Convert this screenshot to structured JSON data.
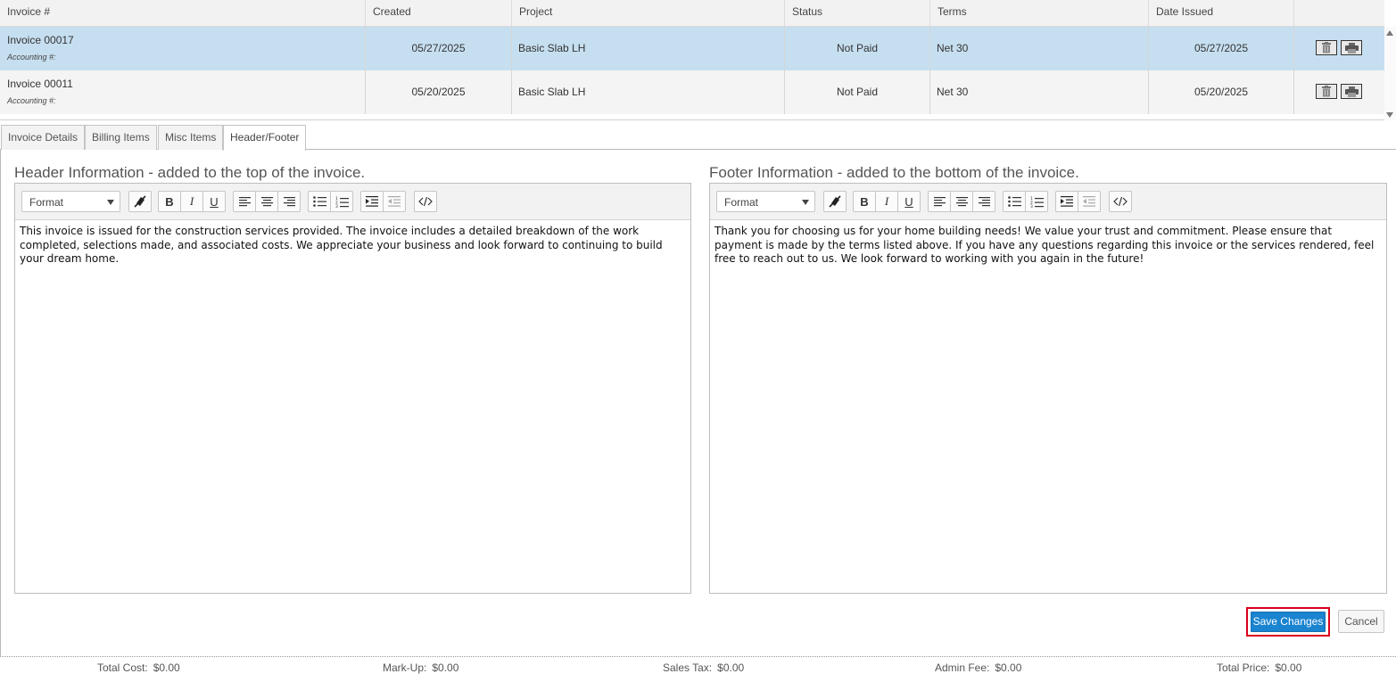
{
  "grid": {
    "columns": [
      "Invoice #",
      "Created",
      "Project",
      "Status",
      "Terms",
      "Date Issued"
    ],
    "rows": [
      {
        "invoice": "Invoice 00017",
        "accounting": "Accounting #:",
        "created": "05/27/2025",
        "project": "Basic Slab LH",
        "status": "Not Paid",
        "terms": "Net 30",
        "date_issued": "05/27/2025",
        "selected": true
      },
      {
        "invoice": "Invoice 00011",
        "accounting": "Accounting #:",
        "created": "05/20/2025",
        "project": "Basic Slab LH",
        "status": "Not Paid",
        "terms": "Net 30",
        "date_issued": "05/20/2025",
        "selected": false
      }
    ],
    "row_icons": [
      "trash-icon",
      "printer-icon"
    ]
  },
  "tabs": [
    {
      "label": "Invoice Details",
      "active": false
    },
    {
      "label": "Billing Items",
      "active": false
    },
    {
      "label": "Misc Items",
      "active": false
    },
    {
      "label": "Header/Footer",
      "active": true
    }
  ],
  "header_section": {
    "title": "Header Information - added to the top of the invoice.",
    "format_label": "Format",
    "content": "This invoice is issued for the construction services provided. The invoice includes a detailed breakdown of the work completed, selections made, and associated costs. We appreciate your business and look forward to continuing to build your dream home."
  },
  "footer_section": {
    "title": "Footer Information - added to the bottom of the invoice.",
    "format_label": "Format",
    "content": "Thank you for choosing us for your home building needs! We value your trust and commitment. Please ensure that payment is made by the terms listed above. If you have any questions regarding this invoice or the services rendered, feel free to reach out to us. We look forward to working with you again in the future!"
  },
  "toolbar_icons": [
    "clear-format-icon",
    "bold-icon",
    "italic-icon",
    "underline-icon",
    "align-left-icon",
    "align-center-icon",
    "align-right-icon",
    "bullet-list-icon",
    "numbered-list-icon",
    "indent-icon",
    "outdent-icon",
    "code-view-icon"
  ],
  "buttons": {
    "save": "Save Changes",
    "cancel": "Cancel"
  },
  "totals": [
    {
      "label": "Total Cost:",
      "value": "$0.00"
    },
    {
      "label": "Mark-Up:",
      "value": "$0.00"
    },
    {
      "label": "Sales Tax:",
      "value": "$0.00"
    },
    {
      "label": "Admin Fee:",
      "value": "$0.00"
    },
    {
      "label": "Total Price:",
      "value": "$0.00"
    }
  ],
  "colors": {
    "selected_row": "#c6dff0",
    "save_button": "#1a84d0",
    "highlight_outline": "#d9001b"
  }
}
